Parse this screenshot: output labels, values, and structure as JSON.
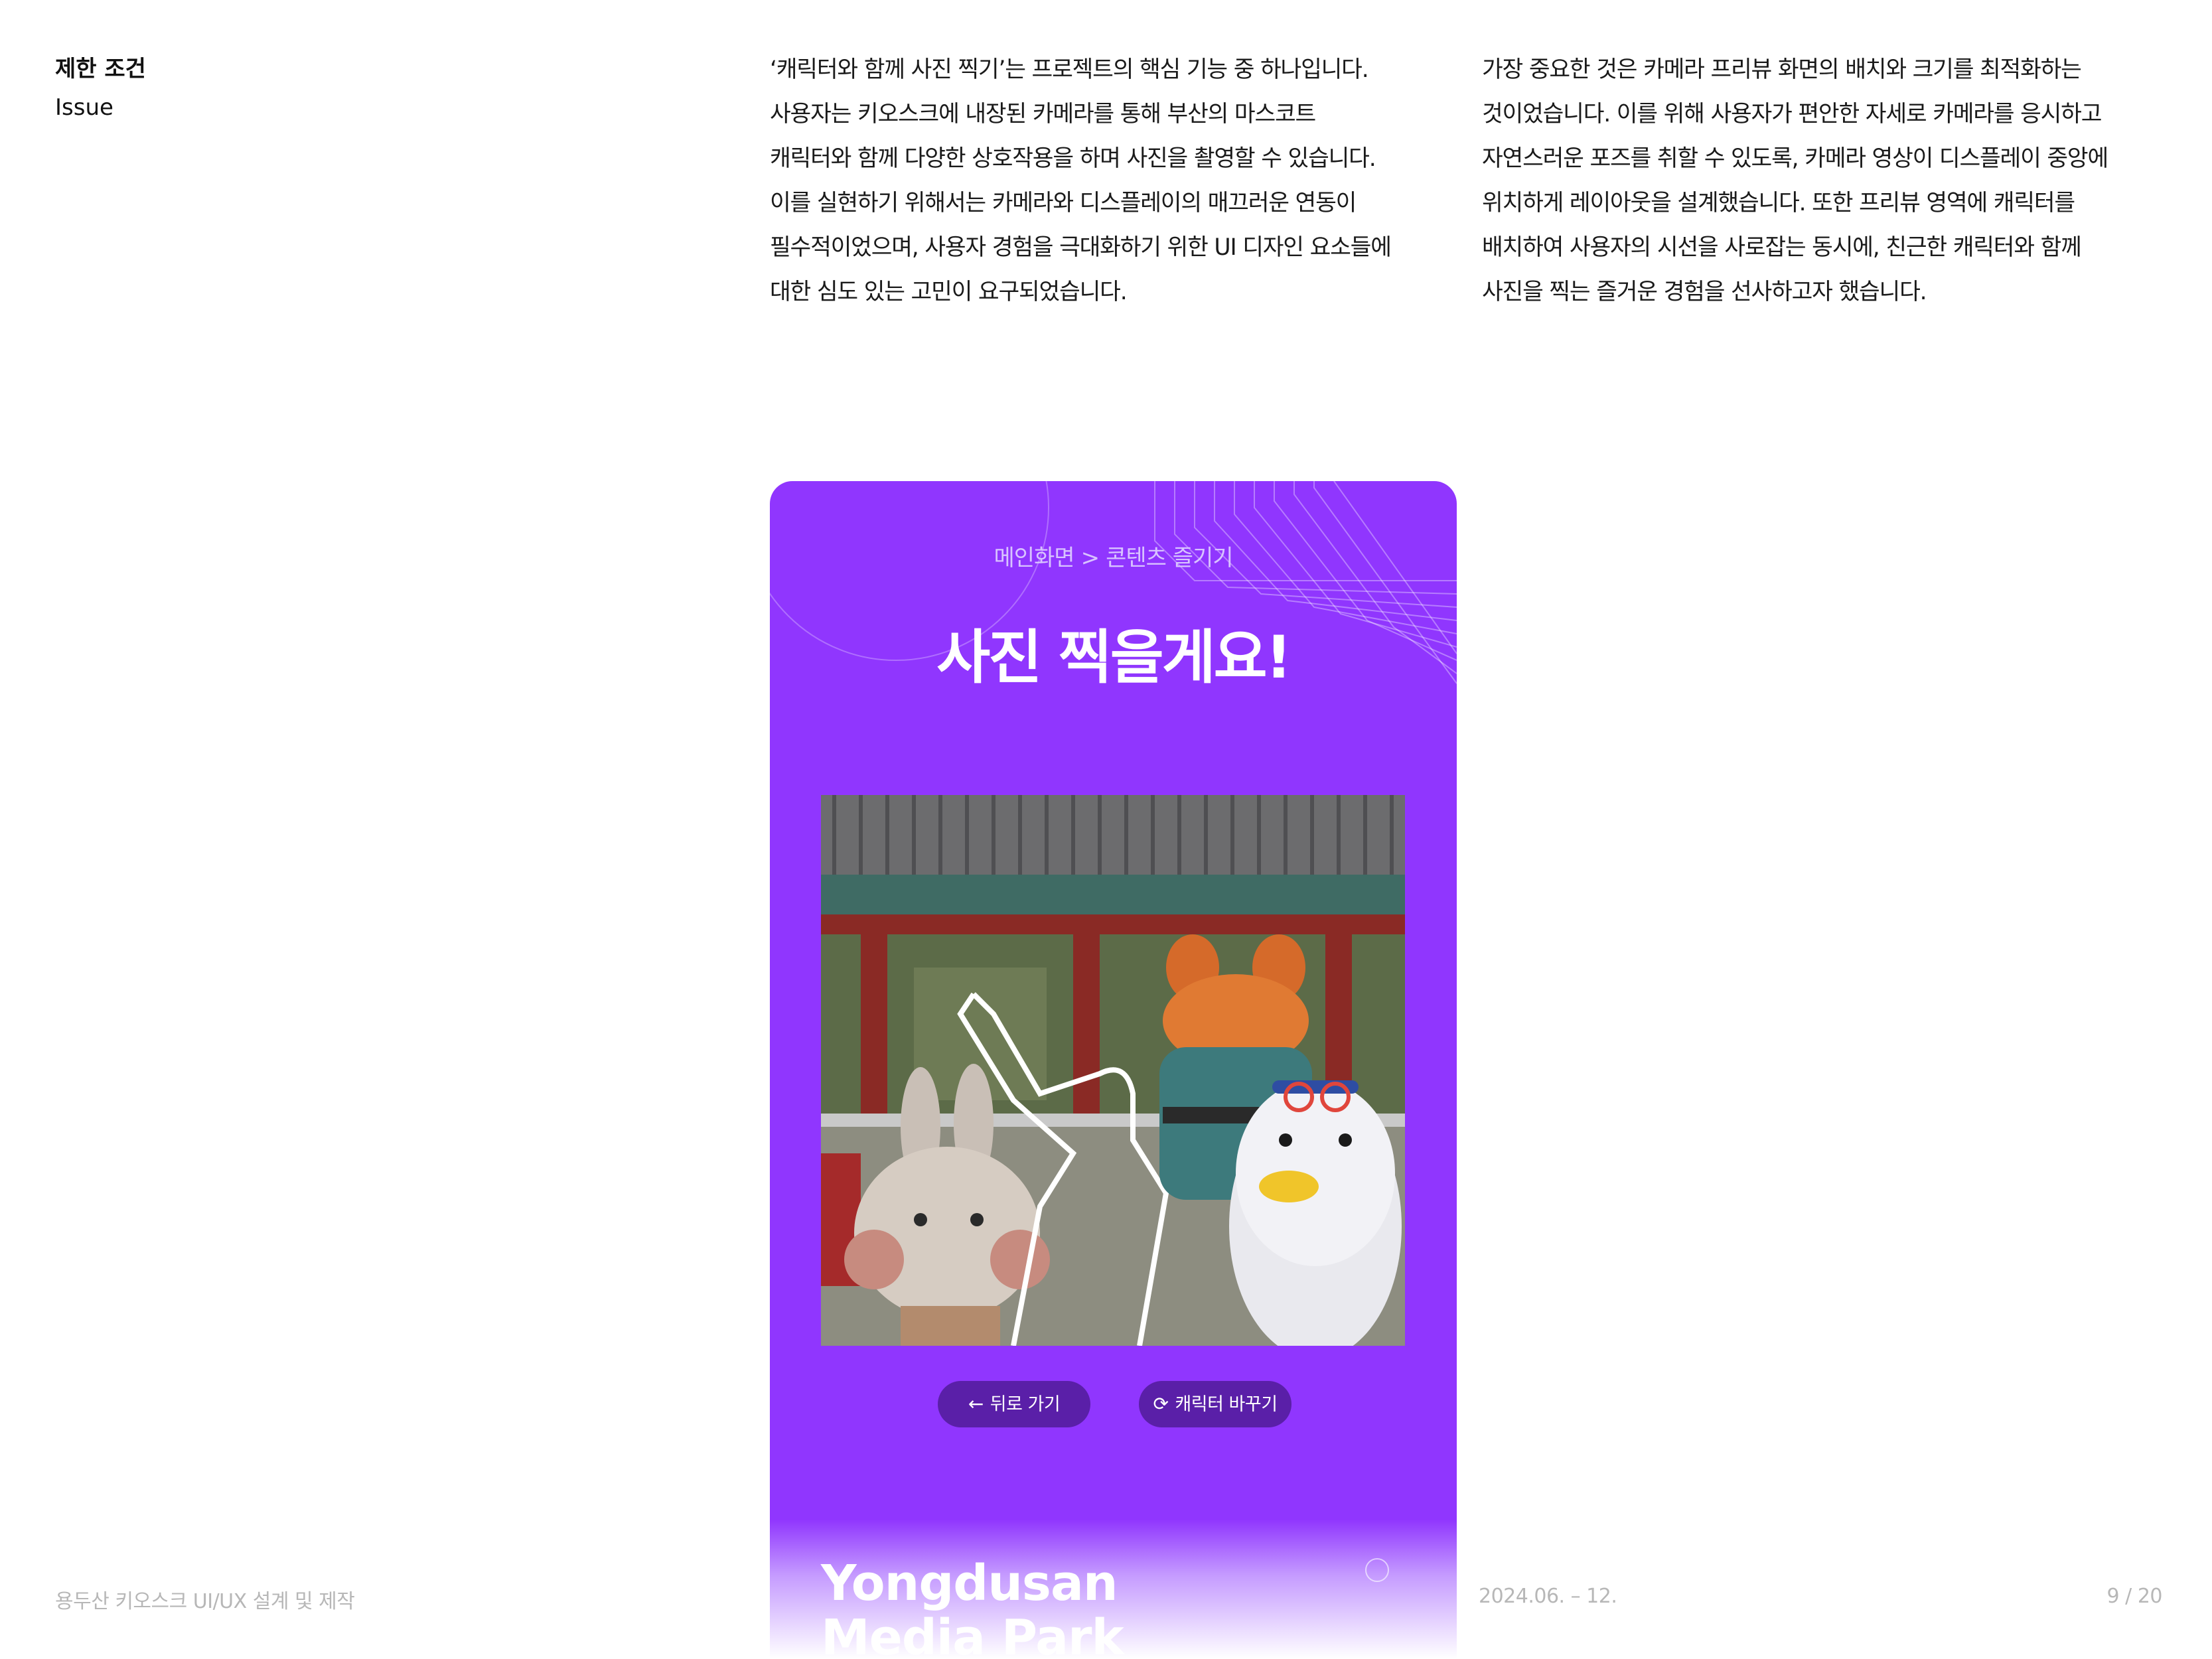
{
  "section": {
    "title": "제한 조건",
    "subtitle": "Issue"
  },
  "paragraph_1": [
    "‘캐릭터와 함께 사진 찍기’는 프로젝트의 핵심 기능 중 하나입니다.",
    "사용자는 키오스크에 내장된 카메라를 통해 부산의 마스코트",
    "캐릭터와 함께 다양한 상호작용을 하며 사진을 촬영할 수 있습니다.",
    "이를 실현하기 위해서는 카메라와 디스플레이의 매끄러운 연동이",
    "필수적이었으며, 사용자 경험을 극대화하기 위한 UI 디자인 요소들에",
    "대한 심도 있는 고민이 요구되었습니다."
  ],
  "paragraph_2": [
    "가장 중요한 것은 카메라 프리뷰 화면의 배치와 크기를 최적화하는",
    "것이었습니다. 이를 위해 사용자가 편안한 자세로 카메라를 응시하고",
    "자연스러운 포즈를 취할 수 있도록, 카메라 영상이 디스플레이 중앙에",
    "위치하게 레이아웃을 설계했습니다. 또한 프리뷰 영역에 캐릭터를",
    "배치하여 사용자의 시선을 사로잡는 동시에, 친근한 캐릭터와 함께",
    "사진을 찍는 즐거운 경험을 선사하고자 했습니다."
  ],
  "kiosk": {
    "breadcrumb_home": "메인화면",
    "breadcrumb_sep": ">",
    "breadcrumb_current": "콘텐츠 즐기기",
    "headline": "사진 찍을게요!",
    "back_label": "뒤로 가기",
    "back_icon": "arrow-left",
    "change_label": "캐릭터 바꾸기",
    "change_icon": "refresh",
    "park_line1": "Yongdusan",
    "park_line2": "Media Park",
    "colors": {
      "background": "#9036fe",
      "button": "#5a1fa8",
      "text": "#ffffff"
    }
  },
  "footer": {
    "project": "용두산 키오스크 UI/UX 설계 및 제작",
    "period": "2024.06. – 12.",
    "page": "9 / 20"
  }
}
